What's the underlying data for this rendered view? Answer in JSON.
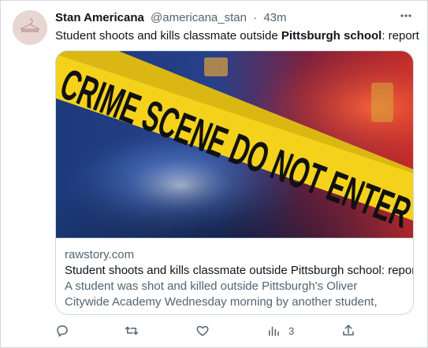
{
  "tweet": {
    "author_name": "Stan Americana",
    "author_handle": "@americana_stan",
    "separator": "·",
    "time": "43m",
    "text_before": "Student shoots and kills classmate outside ",
    "text_bold": "Pittsburgh school",
    "text_after": ": report"
  },
  "card": {
    "image_text": "CRIME SCENE DO NOT ENTER",
    "domain": "rawstory.com",
    "title": "Student shoots and kills classmate outside Pittsburgh school: report",
    "description": "A student was shot and killed outside Pittsburgh's Oliver Citywide Academy Wednesday morning by another student, reports said.It's ..."
  },
  "actions": {
    "reply_icon": "reply-icon",
    "retweet_icon": "retweet-icon",
    "like_icon": "heart-icon",
    "views_icon": "views-icon",
    "views_count": "3",
    "share_icon": "share-icon"
  }
}
